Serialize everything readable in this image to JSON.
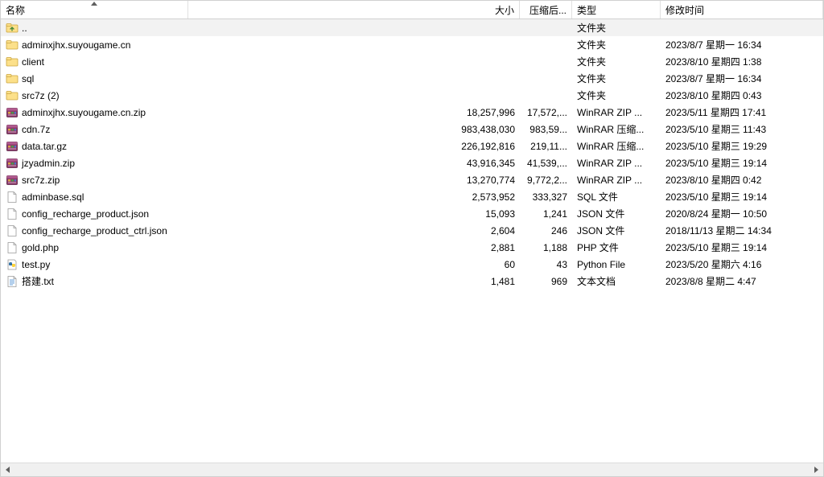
{
  "columns": {
    "name": "名称",
    "size": "大小",
    "compressed": "压缩后...",
    "type": "类型",
    "modified": "修改时间"
  },
  "rows": [
    {
      "icon": "folder-up",
      "name": "..",
      "size": "",
      "compressed": "",
      "type": "文件夹",
      "modified": "",
      "selected": true
    },
    {
      "icon": "folder",
      "name": "adminxjhx.suyougame.cn",
      "size": "",
      "compressed": "",
      "type": "文件夹",
      "modified": "2023/8/7 星期一 16:34"
    },
    {
      "icon": "folder",
      "name": "client",
      "size": "",
      "compressed": "",
      "type": "文件夹",
      "modified": "2023/8/10 星期四 1:38"
    },
    {
      "icon": "folder",
      "name": "sql",
      "size": "",
      "compressed": "",
      "type": "文件夹",
      "modified": "2023/8/7 星期一 16:34"
    },
    {
      "icon": "folder",
      "name": "src7z (2)",
      "size": "",
      "compressed": "",
      "type": "文件夹",
      "modified": "2023/8/10 星期四 0:43"
    },
    {
      "icon": "archive",
      "name": "adminxjhx.suyougame.cn.zip",
      "size": "18,257,996",
      "compressed": "17,572,...",
      "type": "WinRAR ZIP ...",
      "modified": "2023/5/11 星期四 17:41"
    },
    {
      "icon": "archive",
      "name": "cdn.7z",
      "size": "983,438,030",
      "compressed": "983,59...",
      "type": "WinRAR 压缩...",
      "modified": "2023/5/10 星期三 11:43"
    },
    {
      "icon": "archive",
      "name": "data.tar.gz",
      "size": "226,192,816",
      "compressed": "219,11...",
      "type": "WinRAR 压缩...",
      "modified": "2023/5/10 星期三 19:29"
    },
    {
      "icon": "archive",
      "name": "jzyadmin.zip",
      "size": "43,916,345",
      "compressed": "41,539,...",
      "type": "WinRAR ZIP ...",
      "modified": "2023/5/10 星期三 19:14"
    },
    {
      "icon": "archive",
      "name": "src7z.zip",
      "size": "13,270,774",
      "compressed": "9,772,2...",
      "type": "WinRAR ZIP ...",
      "modified": "2023/8/10 星期四 0:42"
    },
    {
      "icon": "file",
      "name": "adminbase.sql",
      "size": "2,573,952",
      "compressed": "333,327",
      "type": "SQL 文件",
      "modified": "2023/5/10 星期三 19:14"
    },
    {
      "icon": "file",
      "name": "config_recharge_product.json",
      "size": "15,093",
      "compressed": "1,241",
      "type": "JSON 文件",
      "modified": "2020/8/24 星期一 10:50"
    },
    {
      "icon": "file",
      "name": "config_recharge_product_ctrl.json",
      "size": "2,604",
      "compressed": "246",
      "type": "JSON 文件",
      "modified": "2018/11/13 星期二 14:34"
    },
    {
      "icon": "file",
      "name": "gold.php",
      "size": "2,881",
      "compressed": "1,188",
      "type": "PHP 文件",
      "modified": "2023/5/10 星期三 19:14"
    },
    {
      "icon": "python",
      "name": "test.py",
      "size": "60",
      "compressed": "43",
      "type": "Python File",
      "modified": "2023/5/20 星期六 4:16"
    },
    {
      "icon": "text",
      "name": "搭建.txt",
      "size": "1,481",
      "compressed": "969",
      "type": "文本文档",
      "modified": "2023/8/8 星期二 4:47"
    }
  ]
}
